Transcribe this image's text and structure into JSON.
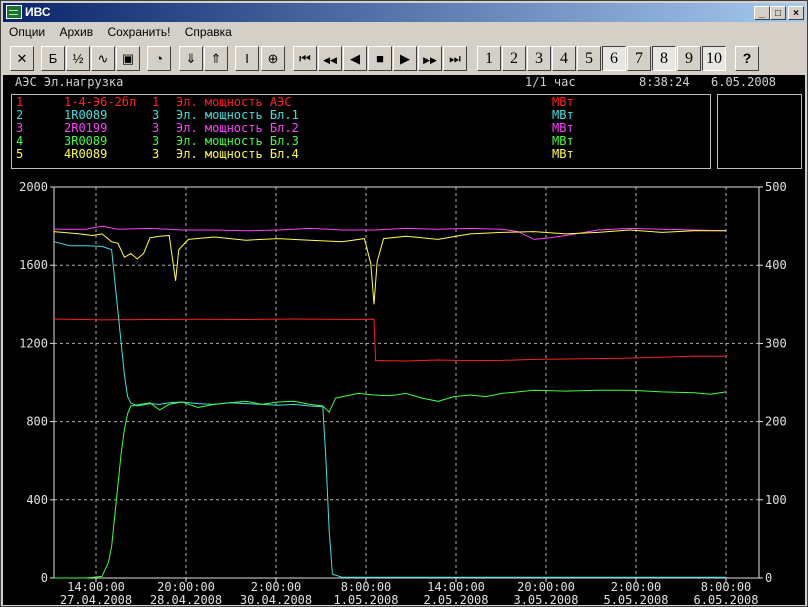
{
  "window": {
    "title": "ИВС",
    "min_label": "_",
    "max_label": "□",
    "close_label": "×"
  },
  "menu": [
    "Опции",
    "Архив",
    "Сохранить!",
    "Справка"
  ],
  "toolbar": {
    "tools": [
      {
        "name": "close-chart-button",
        "glyph": "✕"
      },
      {
        "name": "bold-button",
        "glyph": "Б"
      },
      {
        "name": "scale-button",
        "glyph": "½"
      },
      {
        "name": "wave-button",
        "glyph": "∿"
      },
      {
        "name": "calc-button",
        "glyph": "▣"
      },
      {
        "name": "gauge-button",
        "glyph": "◔"
      },
      {
        "name": "down-button",
        "glyph": "⇓"
      },
      {
        "name": "up-button",
        "glyph": "⇑"
      },
      {
        "name": "cursor-button",
        "glyph": "I"
      },
      {
        "name": "target-button",
        "glyph": "⊕"
      },
      {
        "name": "first-button",
        "glyph": "⏮"
      },
      {
        "name": "rewind-button",
        "glyph": "◀◀"
      },
      {
        "name": "back-button",
        "glyph": "◀"
      },
      {
        "name": "stop-button",
        "glyph": "■"
      },
      {
        "name": "play-button",
        "glyph": "▶"
      },
      {
        "name": "forward-button",
        "glyph": "▶▶"
      },
      {
        "name": "last-button",
        "glyph": "⏭"
      }
    ],
    "pages": [
      "1",
      "2",
      "3",
      "4",
      "5",
      "6",
      "7",
      "8",
      "9",
      "10"
    ],
    "help": "?"
  },
  "header": {
    "title": "АЭС Эл.нагрузка",
    "page": "1/1 час",
    "time": "8:38:24",
    "date": "6.05.2008"
  },
  "legend": [
    {
      "num": "1",
      "tag": "1-4-Э6-2бл",
      "scale": "1",
      "desc": "Эл. мощность АЭС",
      "unit": "МВт",
      "color": "#ff2020"
    },
    {
      "num": "2",
      "tag": "1R0089",
      "scale": "3",
      "desc": "Эл. мощность Бл.1",
      "unit": "МВт",
      "color": "#40e0e0"
    },
    {
      "num": "3",
      "tag": "2R0199",
      "scale": "3",
      "desc": "Эл. мощность Бл.2",
      "unit": "МВт",
      "color": "#ff40ff"
    },
    {
      "num": "4",
      "tag": "3R0089",
      "scale": "3",
      "desc": "Эл. мощность Бл.3",
      "unit": "МВт",
      "color": "#40ff40"
    },
    {
      "num": "5",
      "tag": "4R0089",
      "scale": "3",
      "desc": "Эл. мощность Бл.4",
      "unit": "МВт",
      "color": "#ffff40"
    }
  ],
  "chart_data": {
    "type": "line",
    "y_left": {
      "range": [
        0,
        2000
      ],
      "ticks": [
        "0",
        "400",
        "800",
        "1200",
        "1600",
        "2000"
      ]
    },
    "y_right": {
      "range": [
        0,
        500
      ],
      "ticks": [
        "0",
        "100",
        "200",
        "300",
        "400",
        "500"
      ]
    },
    "x_ticks": [
      {
        "t": "14:00:00",
        "d": "27.04.2008"
      },
      {
        "t": "20:00:00",
        "d": "28.04.2008"
      },
      {
        "t": "2:00:00",
        "d": "30.04.2008"
      },
      {
        "t": "8:00:00",
        "d": "1.05.2008"
      },
      {
        "t": "14:00:00",
        "d": "2.05.2008"
      },
      {
        "t": "20:00:00",
        "d": "3.05.2008"
      },
      {
        "t": "2:00:00",
        "d": "5.05.2008"
      },
      {
        "t": "8:00:00",
        "d": "6.05.2008"
      }
    ],
    "grid": true,
    "series": [
      {
        "name": "1-4-Э6-2бл",
        "color": "#ff2020",
        "axis": "left",
        "points": [
          [
            0,
            1325
          ],
          [
            15,
            1320
          ],
          [
            30,
            1322
          ],
          [
            45,
            1324
          ],
          [
            60,
            1322
          ],
          [
            75,
            1325
          ],
          [
            90,
            1323
          ],
          [
            100,
            1324
          ],
          [
            100.5,
            1112
          ],
          [
            110,
            1110
          ],
          [
            120,
            1115
          ],
          [
            130,
            1112
          ],
          [
            140,
            1113
          ],
          [
            150,
            1118
          ],
          [
            160,
            1120
          ],
          [
            170,
            1122
          ],
          [
            180,
            1125
          ],
          [
            190,
            1130
          ],
          [
            200,
            1135
          ],
          [
            210,
            1134
          ]
        ]
      },
      {
        "name": "1R0089",
        "color": "#40e0e0",
        "axis": "right",
        "points": [
          [
            0,
            430
          ],
          [
            5,
            425
          ],
          [
            10,
            425
          ],
          [
            15,
            424
          ],
          [
            18,
            420
          ],
          [
            19,
            380
          ],
          [
            20,
            340
          ],
          [
            21,
            300
          ],
          [
            22,
            260
          ],
          [
            23,
            232
          ],
          [
            24,
            224
          ],
          [
            26,
            220
          ],
          [
            30,
            223
          ],
          [
            33,
            222
          ],
          [
            36,
            224
          ],
          [
            40,
            225
          ],
          [
            45,
            223
          ],
          [
            50,
            222
          ],
          [
            55,
            224
          ],
          [
            60,
            223
          ],
          [
            65,
            222
          ],
          [
            70,
            221
          ],
          [
            75,
            222
          ],
          [
            80,
            220
          ],
          [
            84,
            219
          ],
          [
            85,
            150
          ],
          [
            86,
            60
          ],
          [
            87,
            5
          ],
          [
            90,
            1
          ],
          [
            120,
            1
          ],
          [
            150,
            1
          ],
          [
            180,
            1
          ],
          [
            210,
            1
          ]
        ]
      },
      {
        "name": "2R0199",
        "color": "#ff40ff",
        "axis": "right",
        "points": [
          [
            0,
            446
          ],
          [
            10,
            446
          ],
          [
            15,
            450
          ],
          [
            20,
            446
          ],
          [
            30,
            447
          ],
          [
            40,
            445
          ],
          [
            50,
            445
          ],
          [
            60,
            444
          ],
          [
            70,
            445
          ],
          [
            80,
            447
          ],
          [
            90,
            445
          ],
          [
            100,
            445
          ],
          [
            110,
            447
          ],
          [
            120,
            446
          ],
          [
            130,
            447
          ],
          [
            140,
            446
          ],
          [
            145,
            443
          ],
          [
            150,
            433
          ],
          [
            155,
            435
          ],
          [
            160,
            438
          ],
          [
            170,
            445
          ],
          [
            180,
            447
          ],
          [
            190,
            446
          ],
          [
            200,
            445
          ],
          [
            210,
            444
          ]
        ]
      },
      {
        "name": "3R0089",
        "color": "#40ff40",
        "axis": "right",
        "points": [
          [
            0,
            0
          ],
          [
            10,
            0
          ],
          [
            15,
            2
          ],
          [
            17,
            20
          ],
          [
            18,
            40
          ],
          [
            19,
            80
          ],
          [
            20,
            120
          ],
          [
            21,
            160
          ],
          [
            22,
            190
          ],
          [
            23,
            210
          ],
          [
            24,
            220
          ],
          [
            30,
            224
          ],
          [
            33,
            215
          ],
          [
            36,
            222
          ],
          [
            40,
            225
          ],
          [
            45,
            218
          ],
          [
            50,
            222
          ],
          [
            55,
            224
          ],
          [
            60,
            226
          ],
          [
            65,
            222
          ],
          [
            70,
            225
          ],
          [
            75,
            226
          ],
          [
            80,
            222
          ],
          [
            84,
            220
          ],
          [
            86,
            212
          ],
          [
            88,
            230
          ],
          [
            95,
            236
          ],
          [
            100,
            234
          ],
          [
            105,
            233
          ],
          [
            110,
            236
          ],
          [
            115,
            230
          ],
          [
            120,
            226
          ],
          [
            125,
            232
          ],
          [
            130,
            234
          ],
          [
            135,
            232
          ],
          [
            140,
            236
          ],
          [
            145,
            238
          ],
          [
            150,
            240
          ],
          [
            160,
            239
          ],
          [
            170,
            240
          ],
          [
            180,
            240
          ],
          [
            190,
            238
          ],
          [
            200,
            237
          ],
          [
            205,
            235
          ],
          [
            210,
            238
          ]
        ]
      },
      {
        "name": "4R0089",
        "color": "#ffff40",
        "axis": "right",
        "points": [
          [
            0,
            443
          ],
          [
            8,
            440
          ],
          [
            12,
            438
          ],
          [
            15,
            440
          ],
          [
            18,
            430
          ],
          [
            20,
            428
          ],
          [
            22,
            410
          ],
          [
            24,
            415
          ],
          [
            26,
            408
          ],
          [
            28,
            415
          ],
          [
            30,
            435
          ],
          [
            33,
            437
          ],
          [
            36,
            438
          ],
          [
            38,
            380
          ],
          [
            39,
            420
          ],
          [
            42,
            433
          ],
          [
            50,
            436
          ],
          [
            60,
            432
          ],
          [
            70,
            434
          ],
          [
            80,
            432
          ],
          [
            90,
            430
          ],
          [
            97,
            434
          ],
          [
            99,
            402
          ],
          [
            100,
            350
          ],
          [
            101,
            405
          ],
          [
            103,
            434
          ],
          [
            110,
            437
          ],
          [
            120,
            433
          ],
          [
            130,
            440
          ],
          [
            140,
            442
          ],
          [
            150,
            443
          ],
          [
            160,
            440
          ],
          [
            170,
            442
          ],
          [
            180,
            445
          ],
          [
            190,
            442
          ],
          [
            200,
            444
          ],
          [
            210,
            444
          ]
        ]
      }
    ]
  }
}
